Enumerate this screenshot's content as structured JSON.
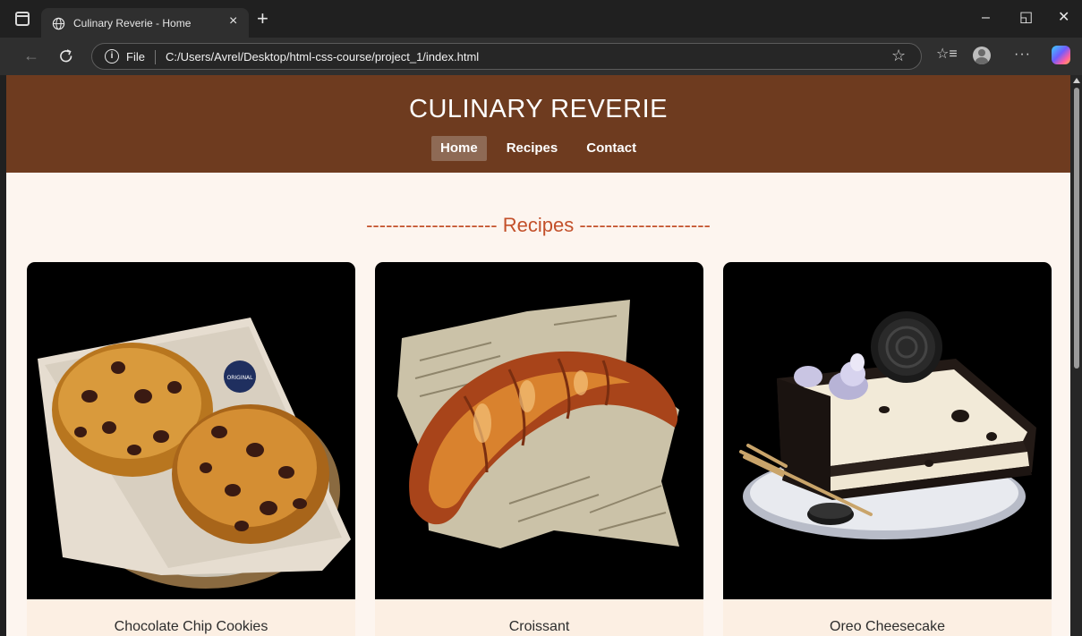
{
  "browser": {
    "tab_title": "Culinary Reverie - Home",
    "new_tab_symbol": "+",
    "close_tab_symbol": "×",
    "file_label": "File",
    "url": "C:/Users/Avrel/Desktop/html-css-course/project_1/index.html",
    "window_controls": {
      "minimize": "–",
      "restore": "◱",
      "close": "✕"
    },
    "more_symbol": "···"
  },
  "site": {
    "title": "CULINARY REVERIE",
    "nav": [
      {
        "label": "Home",
        "active": true
      },
      {
        "label": "Recipes",
        "active": false
      },
      {
        "label": "Contact",
        "active": false
      }
    ],
    "section_title": "-------------------- Recipes --------------------",
    "recipes": [
      {
        "name": "Chocolate Chip Cookies",
        "image": "cookies-illustration"
      },
      {
        "name": "Croissant",
        "image": "croissant-illustration"
      },
      {
        "name": "Oreo Cheesecake",
        "image": "cheesecake-illustration"
      }
    ],
    "badge_text": "ORIGINAL"
  },
  "colors": {
    "header_bg": "#6e3b1f",
    "page_bg": "#fdf5ef",
    "accent": "#c3502a",
    "card_caption_bg": "#fcefe3",
    "active_nav_bg": "#8e6a55"
  }
}
